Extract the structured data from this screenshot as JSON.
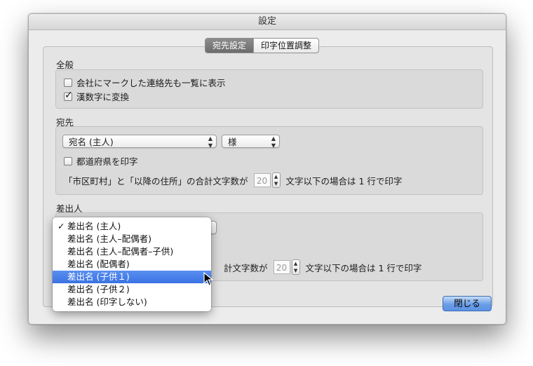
{
  "window": {
    "title": "設定"
  },
  "tabs": [
    {
      "label": "宛先設定",
      "selected": true
    },
    {
      "label": "印字位置調整",
      "selected": false
    }
  ],
  "general": {
    "section_label": "全般",
    "show_company_marked": {
      "label": "会社にマークした連絡先も一覧に表示",
      "checked": false
    },
    "kanji_numbers": {
      "label": "漢数字に変換",
      "checked": true
    }
  },
  "recipient": {
    "section_label": "宛先",
    "name_popup": "宛名 (主人)",
    "honorific_popup": "様",
    "print_prefecture": {
      "label": "都道府県を印字",
      "checked": false
    },
    "line_rule": {
      "prefix": "「市区町村」と「以降の住所」の合計文字数が",
      "value": "20",
      "suffix": "文字以下の場合は 1 行で印字"
    }
  },
  "sender": {
    "section_label": "差出人",
    "line_rule": {
      "prefix": "計文字数が",
      "value": "20",
      "suffix": "文字以下の場合は 1 行で印字"
    }
  },
  "sender_menu": {
    "check_mark": "✓",
    "items": [
      {
        "label": "差出名 (主人)",
        "checked": true,
        "highlighted": false
      },
      {
        "label": "差出名 (主人–配偶者)",
        "checked": false,
        "highlighted": false
      },
      {
        "label": "差出名 (主人–配偶者–子供)",
        "checked": false,
        "highlighted": false
      },
      {
        "label": "差出名 (配偶者)",
        "checked": false,
        "highlighted": false
      },
      {
        "label": "差出名 (子供１)",
        "checked": false,
        "highlighted": true
      },
      {
        "label": "差出名 (子供２)",
        "checked": false,
        "highlighted": false
      },
      {
        "label": "差出名 (印字しない)",
        "checked": false,
        "highlighted": false
      }
    ]
  },
  "buttons": {
    "close": "閉じる"
  },
  "colors": {
    "accent": "#3a72e3",
    "highlight": "#5a8ff0"
  }
}
